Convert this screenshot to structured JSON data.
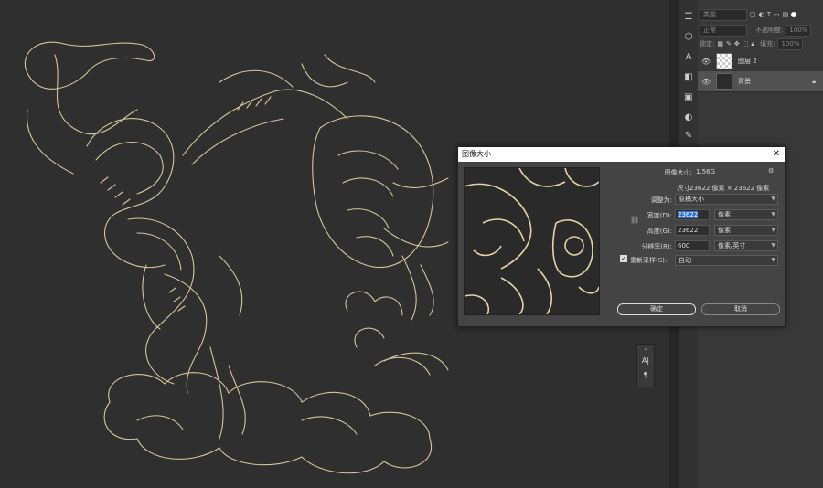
{
  "colors": {
    "line_art": "#d8c59a",
    "canvas": "#2f2f2f",
    "accent": "#2f6fd2"
  },
  "layers_panel": {
    "filter_kind": "类型",
    "blend_mode": "正常",
    "opacity_label": "不透明度:",
    "opacity_value": "100%",
    "lock_label": "锁定:",
    "fill_label": "填充:",
    "fill_value": "100%",
    "layers": [
      {
        "name": "图层 2",
        "selected": false,
        "visible": true,
        "locked": false
      },
      {
        "name": "背景",
        "selected": true,
        "visible": true,
        "locked": true
      }
    ]
  },
  "dialog": {
    "title": "图像大小",
    "image_size_label": "图像大小:",
    "image_size_value": "1.56G",
    "dimensions_label": "尺寸:",
    "dimensions_value": "23622 像素 × 23622 像素",
    "fit_to_label": "调整为:",
    "fit_to_value": "原稿大小",
    "width_label": "宽度(D):",
    "width_value": "23622",
    "width_unit": "像素",
    "height_label": "高度(G):",
    "height_value": "23622",
    "height_unit": "像素",
    "resolution_label": "分辨率(R):",
    "resolution_value": "600",
    "resolution_unit": "像素/英寸",
    "resample_label": "重新采样(S):",
    "resample_checked": true,
    "resample_value": "自动",
    "ok_label": "确定",
    "cancel_label": "取消"
  },
  "mini_panel": {
    "icons": [
      "character-icon",
      "paragraph-icon"
    ]
  }
}
